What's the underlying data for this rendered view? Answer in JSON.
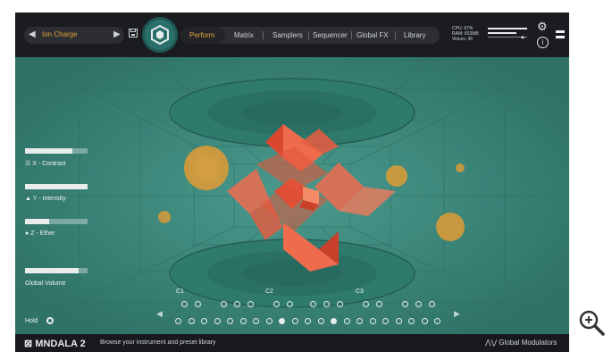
{
  "topbar": {
    "preset_name": "Ion Charge",
    "prev_symbol": "◀",
    "next_symbol": "▶",
    "tabs": [
      {
        "label": "Perform",
        "active": true
      },
      {
        "label": "Matrix",
        "active": false
      },
      {
        "label": "Samplers",
        "active": false
      },
      {
        "label": "Sequencer",
        "active": false
      },
      {
        "label": "Global FX",
        "active": false
      },
      {
        "label": "Library",
        "active": false
      }
    ],
    "stats": {
      "cpu": "CPU: 67%",
      "ram": "RAM: 833MB",
      "voices": "Voices: 36"
    },
    "brand_text": "=▲●"
  },
  "controls": {
    "x_label": "X - Contrast",
    "y_label": "Y - Intensity",
    "z_label": "Z - Ether",
    "volume_label": "Global Volume",
    "x_value": 0.75,
    "y_value": 1.0,
    "z_value": 0.38,
    "volume_value": 0.85,
    "hold_label": "Hold"
  },
  "keyboard": {
    "octave_labels": [
      "C1",
      "C2",
      "C3"
    ],
    "active_keys": [
      8,
      12
    ]
  },
  "footer": {
    "logo": "MNDALA 2",
    "status": "Browse your instrument and preset library",
    "global_modulators": "Global Modulators"
  },
  "colors": {
    "accent": "#e6a23c",
    "stage_bg": "#3f8c80",
    "shape": "#e4553a",
    "orb": "#e8a23a"
  },
  "zoom_icon": "magnifier-plus-icon"
}
